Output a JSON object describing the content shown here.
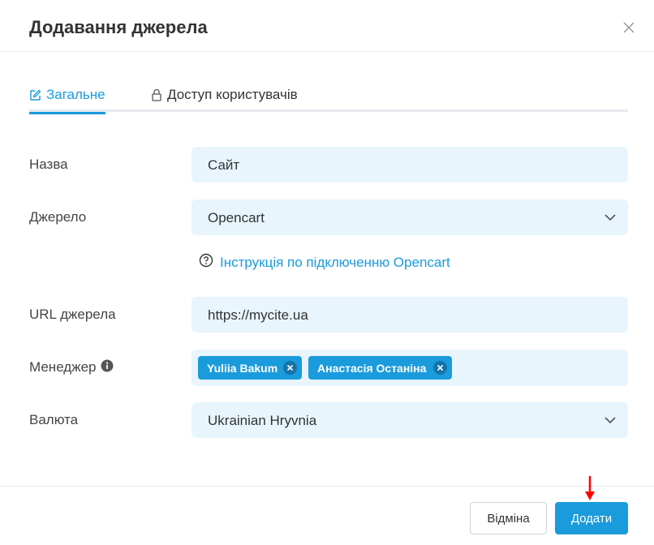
{
  "dialog": {
    "title": "Додавання джерела"
  },
  "tabs": [
    {
      "label": "Загальне",
      "active": true,
      "icon": "edit-icon"
    },
    {
      "label": "Доступ користувачів",
      "active": false,
      "icon": "lock-icon"
    }
  ],
  "form": {
    "name": {
      "label": "Назва",
      "value": "Сайт"
    },
    "source": {
      "label": "Джерело",
      "value": "Opencart"
    },
    "help_link": "Інструкція по підключенню Opencart",
    "url": {
      "label": "URL джерела",
      "value": "https://mycite.ua"
    },
    "manager": {
      "label": "Менеджер",
      "tags": [
        "Yuliia Bakum",
        "Анастасія Останіна"
      ]
    },
    "currency": {
      "label": "Валюта",
      "value": "Ukrainian Hryvnia"
    }
  },
  "footer": {
    "cancel_label": "Відміна",
    "add_label": "Додати"
  },
  "colors": {
    "accent": "#1a9bdc",
    "field_bg": "#e8f5fd",
    "annotation_arrow": "#ff0000"
  }
}
